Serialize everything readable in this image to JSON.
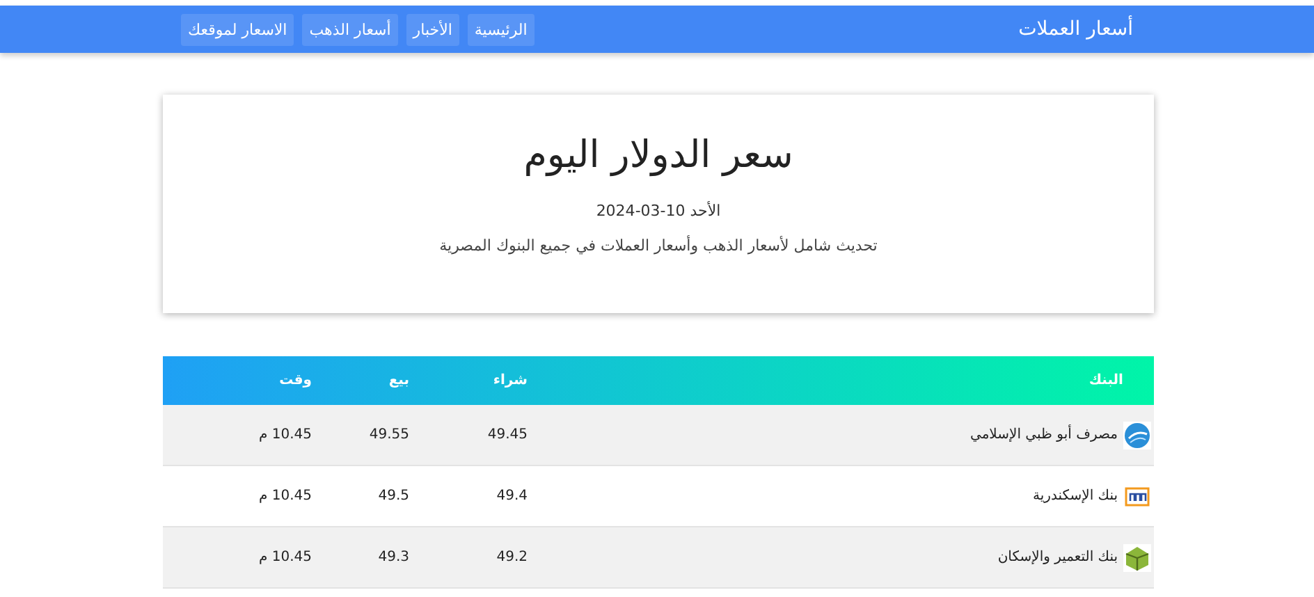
{
  "navbar": {
    "brand": "أسعار العملات",
    "links": [
      "الرئيسية",
      "الأخبار",
      "أسعار الذهب",
      "الاسعار لموقعك"
    ]
  },
  "hero": {
    "title": "سعر الدولار اليوم",
    "date": "الأحد 10-03-2024",
    "subtitle": "تحديث شامل لأسعار الذهب وأسعار العملات في جميع البنوك المصرية"
  },
  "table": {
    "columns": [
      "البنك",
      "شراء",
      "بيع",
      "وقت"
    ],
    "rows": [
      {
        "bank": "مصرف أبو ظبي الإسلامي",
        "buy": "49.45",
        "sell": "49.55",
        "time": "10.45 م"
      },
      {
        "bank": "بنك الإسكندرية",
        "buy": "49.4",
        "sell": "49.5",
        "time": "10.45 م"
      },
      {
        "bank": "بنك التعمير والإسكان",
        "buy": "49.2",
        "sell": "49.3",
        "time": "10.45 م"
      }
    ]
  }
}
